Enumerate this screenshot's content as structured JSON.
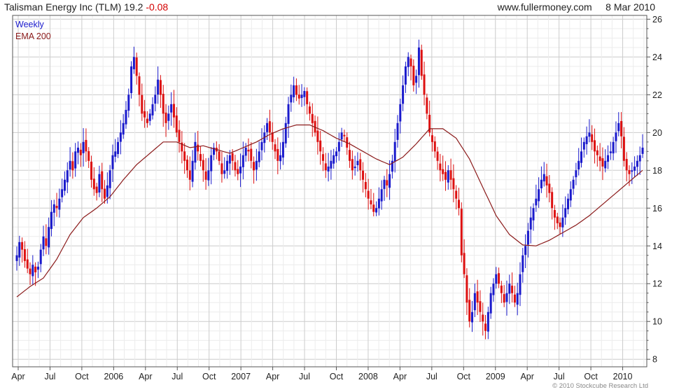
{
  "header": {
    "title": "Talisman Energy Inc (TLM)",
    "price": "19.2",
    "change": "-0.08",
    "site": "www.fullermoney.com",
    "date": "8 Mar 2010"
  },
  "legend": {
    "weekly": "Weekly",
    "ema": "EMA 200"
  },
  "copyright": "© 2010 Stockcube Research Ltd",
  "colors": {
    "up": "#1a1acc",
    "down": "#dd1111",
    "ema": "#8b1a1a",
    "grid": "#d8d8d8",
    "axis": "#555555"
  },
  "chart_data": {
    "type": "line",
    "grid": true,
    "y_axis_side": "right",
    "ylim": [
      7.6,
      26.2
    ],
    "y_ticks": [
      "8",
      "10",
      "12",
      "14",
      "16",
      "18",
      "20",
      "22",
      "24",
      "26"
    ],
    "x_ticks": [
      "Apr",
      "Jul",
      "Oct",
      "2006",
      "Apr",
      "Jul",
      "Oct",
      "2007",
      "Apr",
      "Jul",
      "Oct",
      "2008",
      "Apr",
      "Jul",
      "Oct",
      "2009",
      "Apr",
      "Jul",
      "Oct",
      "2010"
    ],
    "series": [
      {
        "name": "Weekly",
        "style": "ohlc-bars",
        "close": [
          13.5,
          14.2,
          13.8,
          13.2,
          12.8,
          12.5,
          13.0,
          12.6,
          12.9,
          13.8,
          14.5,
          14.0,
          15.0,
          15.8,
          16.2,
          16.0,
          16.5,
          17.0,
          17.5,
          18.0,
          18.5,
          18.0,
          19.0,
          19.2,
          18.8,
          19.5,
          19.0,
          18.5,
          17.5,
          17.0,
          16.8,
          17.8,
          17.0,
          16.5,
          17.2,
          18.0,
          18.8,
          19.0,
          19.5,
          20.0,
          20.5,
          21.2,
          22.0,
          23.5,
          24.0,
          23.0,
          22.0,
          21.0,
          20.8,
          20.5,
          21.0,
          21.5,
          22.0,
          22.8,
          22.0,
          21.0,
          20.5,
          21.0,
          21.5,
          20.8,
          20.0,
          19.5,
          19.0,
          18.5,
          18.0,
          17.5,
          18.5,
          19.5,
          19.0,
          18.5,
          18.0,
          17.5,
          18.0,
          18.8,
          19.2,
          19.0,
          18.5,
          17.8,
          18.0,
          18.5,
          18.8,
          18.5,
          18.0,
          17.8,
          18.2,
          18.8,
          19.2,
          19.0,
          18.5,
          18.0,
          18.5,
          19.0,
          19.5,
          20.0,
          20.5,
          20.0,
          19.5,
          19.0,
          18.5,
          18.8,
          19.5,
          20.5,
          21.5,
          22.0,
          22.5,
          22.0,
          21.8,
          22.0,
          22.2,
          21.5,
          21.0,
          20.5,
          20.0,
          19.5,
          19.0,
          18.5,
          18.0,
          18.2,
          18.5,
          18.8,
          19.0,
          19.5,
          20.0,
          19.8,
          19.2,
          18.5,
          18.0,
          18.2,
          18.5,
          18.0,
          17.5,
          17.0,
          16.5,
          16.2,
          15.8,
          16.0,
          16.5,
          17.0,
          17.5,
          17.2,
          17.8,
          18.5,
          19.5,
          20.5,
          21.5,
          22.5,
          23.5,
          24.0,
          23.5,
          22.5,
          23.0,
          24.5,
          23.0,
          22.0,
          21.0,
          20.0,
          19.5,
          19.0,
          18.5,
          18.0,
          17.8,
          17.5,
          18.0,
          17.5,
          17.0,
          16.5,
          16.0,
          13.5,
          12.5,
          11.0,
          10.0,
          10.5,
          11.5,
          11.0,
          10.5,
          10.0,
          9.5,
          10.5,
          11.5,
          12.0,
          12.5,
          12.0,
          11.5,
          11.0,
          11.5,
          12.0,
          11.5,
          11.0,
          11.5,
          12.5,
          13.5,
          14.0,
          14.8,
          15.5,
          16.0,
          16.5,
          17.0,
          17.5,
          17.8,
          17.2,
          16.8,
          16.0,
          15.5,
          15.2,
          15.0,
          15.5,
          16.0,
          16.5,
          17.0,
          17.5,
          18.0,
          18.5,
          19.0,
          19.5,
          19.8,
          20.0,
          19.5,
          19.0,
          18.8,
          18.5,
          18.2,
          18.5,
          18.8,
          19.0,
          19.5,
          20.0,
          20.5,
          19.8,
          18.5,
          18.0,
          17.8,
          18.0,
          18.2,
          18.5,
          18.8,
          19.2
        ]
      },
      {
        "name": "EMA 200",
        "style": "line",
        "anchor_weeks": [
          0,
          5,
          10,
          15,
          20,
          25,
          30,
          35,
          40,
          45,
          50,
          55,
          60,
          65,
          70,
          75,
          80,
          85,
          90,
          95,
          100,
          105,
          110,
          115,
          120,
          125,
          130,
          135,
          140,
          145,
          150,
          155,
          160,
          165,
          170,
          175,
          180,
          185,
          190,
          195,
          200,
          205,
          210,
          215,
          220,
          225,
          230,
          235
        ],
        "anchor_values": [
          11.3,
          11.85,
          12.3,
          13.3,
          14.6,
          15.5,
          16.0,
          16.6,
          17.5,
          18.3,
          18.9,
          19.5,
          19.5,
          19.2,
          19.3,
          19.1,
          18.9,
          19.2,
          19.5,
          19.9,
          20.2,
          20.4,
          20.4,
          20.1,
          19.7,
          19.4,
          19.0,
          18.6,
          18.3,
          18.7,
          19.4,
          20.2,
          20.2,
          19.7,
          18.6,
          17.1,
          15.6,
          14.6,
          14.05,
          14.0,
          14.3,
          14.7,
          15.1,
          15.6,
          16.2,
          16.8,
          17.4,
          18.0
        ]
      }
    ]
  }
}
